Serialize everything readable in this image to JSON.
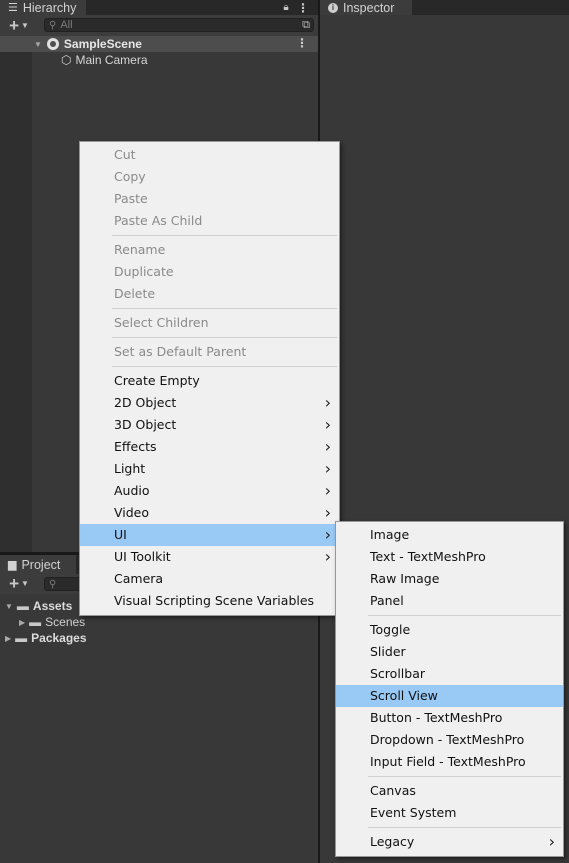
{
  "hierarchy": {
    "tab_label": "Hierarchy",
    "search_placeholder": "All",
    "scene_name": "SampleScene",
    "items": [
      "Main Camera"
    ]
  },
  "inspector": {
    "tab_label": "Inspector"
  },
  "project": {
    "tab_label": "Project",
    "tree": {
      "assets": "Assets",
      "scenes": "Scenes",
      "packages": "Packages"
    }
  },
  "context_menu": {
    "groups": [
      [
        {
          "label": "Cut",
          "disabled": true
        },
        {
          "label": "Copy",
          "disabled": true
        },
        {
          "label": "Paste",
          "disabled": true
        },
        {
          "label": "Paste As Child",
          "disabled": true
        }
      ],
      [
        {
          "label": "Rename",
          "disabled": true
        },
        {
          "label": "Duplicate",
          "disabled": true
        },
        {
          "label": "Delete",
          "disabled": true
        }
      ],
      [
        {
          "label": "Select Children",
          "disabled": true
        }
      ],
      [
        {
          "label": "Set as Default Parent",
          "disabled": true
        }
      ],
      [
        {
          "label": "Create Empty"
        },
        {
          "label": "2D Object",
          "submenu": true
        },
        {
          "label": "3D Object",
          "submenu": true
        },
        {
          "label": "Effects",
          "submenu": true
        },
        {
          "label": "Light",
          "submenu": true
        },
        {
          "label": "Audio",
          "submenu": true
        },
        {
          "label": "Video",
          "submenu": true
        },
        {
          "label": "UI",
          "submenu": true,
          "highlight": true
        },
        {
          "label": "UI Toolkit",
          "submenu": true
        },
        {
          "label": "Camera"
        },
        {
          "label": "Visual Scripting Scene Variables"
        }
      ]
    ]
  },
  "ui_submenu": {
    "groups": [
      [
        {
          "label": "Image"
        },
        {
          "label": "Text - TextMeshPro"
        },
        {
          "label": "Raw Image"
        },
        {
          "label": "Panel"
        }
      ],
      [
        {
          "label": "Toggle"
        },
        {
          "label": "Slider"
        },
        {
          "label": "Scrollbar"
        },
        {
          "label": "Scroll View",
          "highlight": true
        },
        {
          "label": "Button - TextMeshPro"
        },
        {
          "label": "Dropdown - TextMeshPro"
        },
        {
          "label": "Input Field - TextMeshPro"
        }
      ],
      [
        {
          "label": "Canvas"
        },
        {
          "label": "Event System"
        }
      ],
      [
        {
          "label": "Legacy",
          "submenu": true
        }
      ]
    ]
  },
  "colors": {
    "panel_bg": "#383838",
    "menu_bg": "#f0f0f0",
    "menu_highlight": "#99c9f5",
    "scene_row_bg": "#4d4d4d"
  }
}
